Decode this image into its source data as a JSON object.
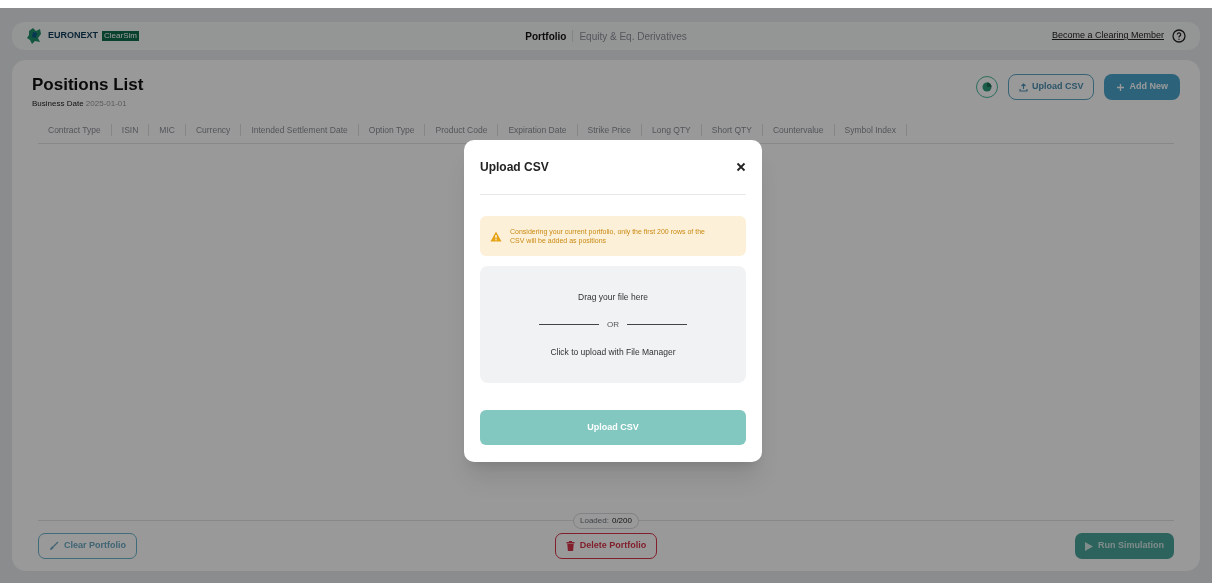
{
  "header": {
    "brand": "EURONEXT",
    "brand_badge": "ClearSim",
    "nav": [
      {
        "label": "Portfolio",
        "selected": true
      },
      {
        "label": "Equity & Eq. Derivatives",
        "selected": false
      }
    ],
    "link": "Become a Clearing Member"
  },
  "positions": {
    "title": "Positions List",
    "business_date_label": "Business Date",
    "business_date": "2025-01-01",
    "actions": [
      "Upload CSV",
      "Add New"
    ],
    "columns": [
      "Contract Type",
      "ISIN",
      "MIC",
      "Currency",
      "Intended Settlement Date",
      "Option Type",
      "Product Code",
      "Expiration Date",
      "Strike Price",
      "Long QTY",
      "Short QTY",
      "Countervalue",
      "Symbol Index"
    ],
    "loaded_label": "Loaded:",
    "loaded": "0/200",
    "footer_buttons": [
      {
        "kind": "clear",
        "label": "Clear Portfolio"
      },
      {
        "kind": "delete",
        "label": "Delete Portfolio"
      },
      {
        "kind": "run",
        "label": "Run Simulation"
      }
    ]
  },
  "dialog": {
    "title": "Upload CSV",
    "warning": "Considering your current portfolio, only the first 200 rows of the CSV will be added as positions",
    "drop_text": "Drag your file here",
    "separator": "OR",
    "click_text": "Click to upload with File Manager",
    "submit": "Upload CSV"
  }
}
